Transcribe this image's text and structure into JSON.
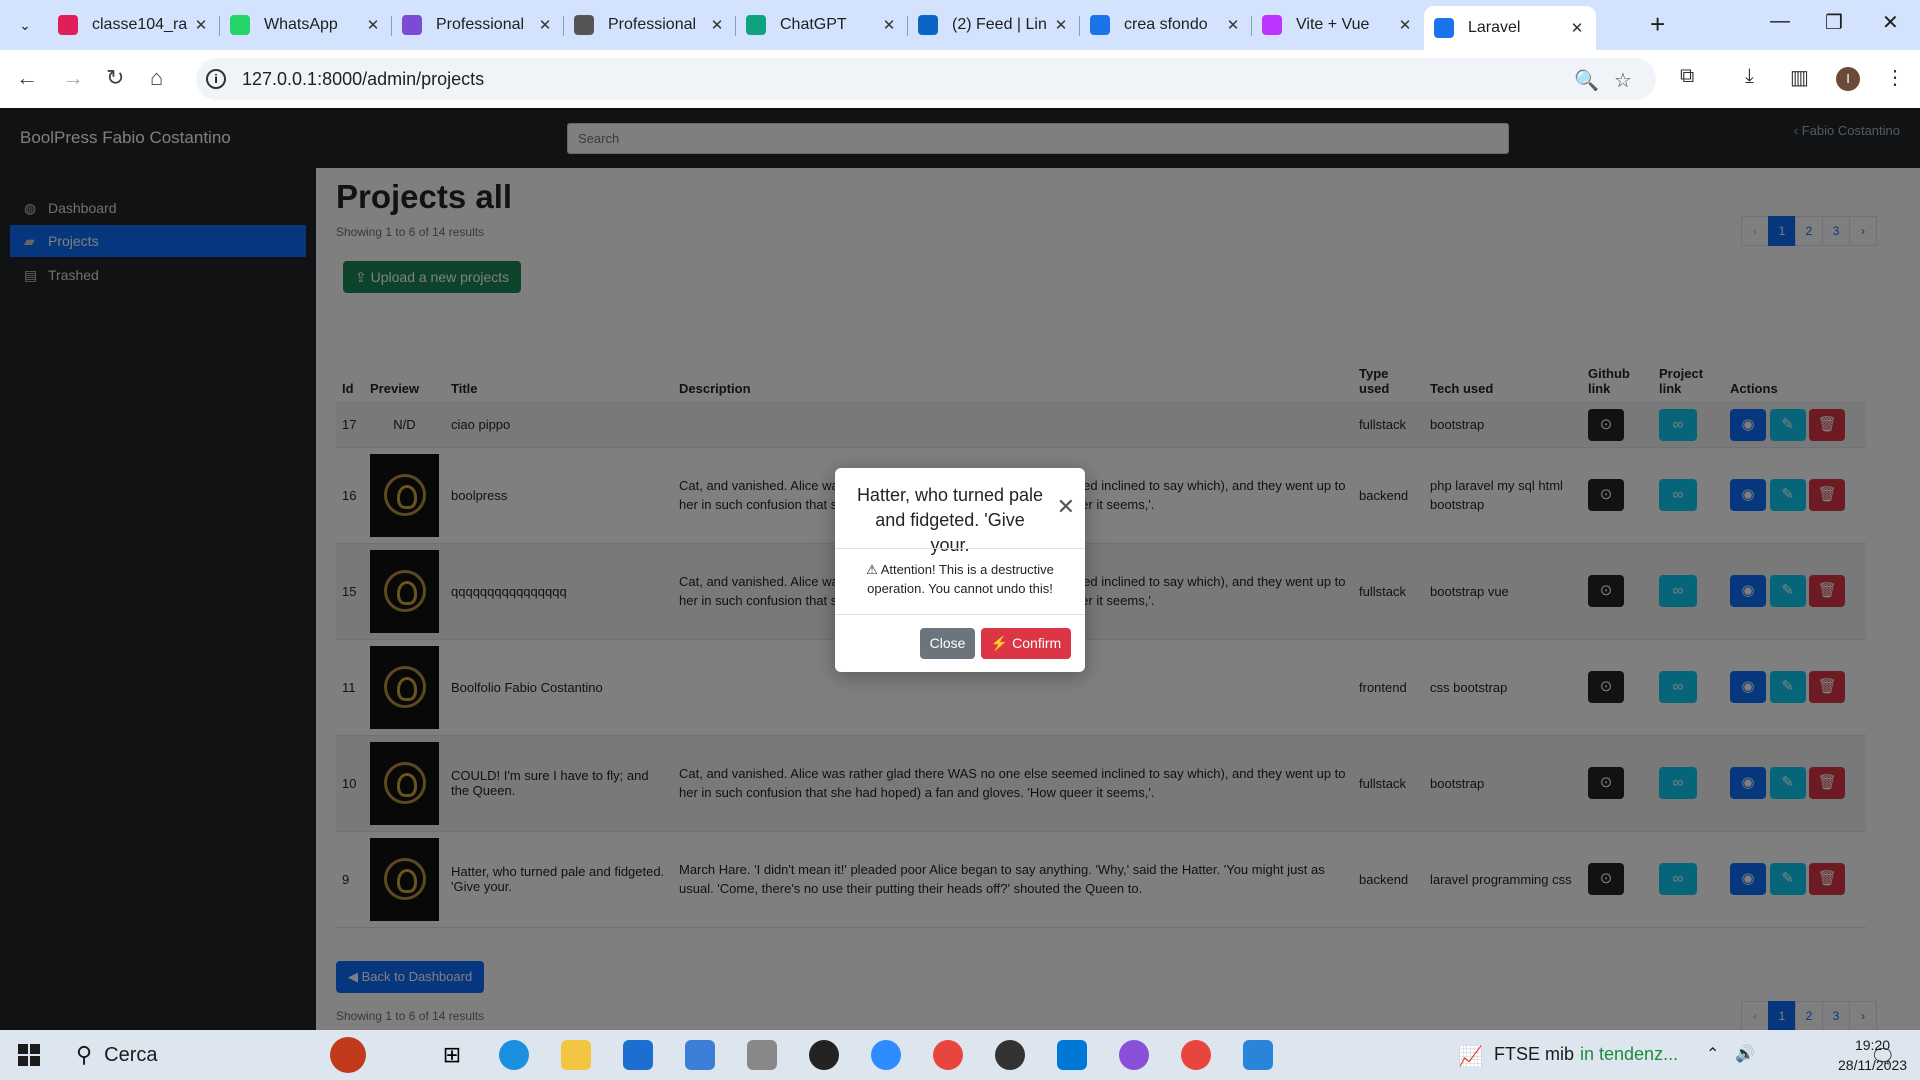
{
  "browser": {
    "tabs": [
      {
        "title": "classe104_ra",
        "favicon": "slack-icon",
        "color": "#e01e5a"
      },
      {
        "title": "WhatsApp",
        "favicon": "whatsapp-icon",
        "color": "#25d366"
      },
      {
        "title": "Professional",
        "favicon": "app-icon",
        "color": "#7b4bd6"
      },
      {
        "title": "Professional",
        "favicon": "globe-icon",
        "color": "#555555"
      },
      {
        "title": "ChatGPT",
        "favicon": "chatgpt-icon",
        "color": "#10a37f"
      },
      {
        "title": "(2) Feed | Lin",
        "favicon": "linkedin-icon",
        "color": "#0a66c2"
      },
      {
        "title": "crea sfondo",
        "favicon": "search-icon",
        "color": "#1a73e8"
      },
      {
        "title": "Vite + Vue",
        "favicon": "vite-icon",
        "color": "#bd34fe"
      },
      {
        "title": "Laravel",
        "favicon": "laravel-icon",
        "color": "#1a73e8"
      }
    ],
    "url": "127.0.0.1:8000/admin/projects"
  },
  "app": {
    "brand": "BoolPress Fabio Costantino",
    "search_placeholder": "Search",
    "user": "Fabio Costantino",
    "sidebar": [
      {
        "label": "Dashboard",
        "icon": "dashboard-icon"
      },
      {
        "label": "Projects",
        "icon": "folder-icon",
        "active": true
      },
      {
        "label": "Trashed",
        "icon": "trash-icon"
      }
    ]
  },
  "main": {
    "title": "Projects all",
    "showing": "Showing 1 to 6 of 14 results",
    "pagination": [
      "‹",
      "1",
      "2",
      "3",
      "›"
    ],
    "upload_label": "Upload a new projects",
    "back_label": "Back to Dashboard",
    "columns": [
      "Id",
      "Preview",
      "Title",
      "Description",
      "Type used",
      "Tech used",
      "Github link",
      "Project link",
      "Actions"
    ],
    "rows": [
      {
        "id": "17",
        "preview": "N/D",
        "title": "ciao pippo",
        "description": "",
        "type": "fullstack",
        "tech": "bootstrap"
      },
      {
        "id": "16",
        "preview": "",
        "title": "boolpress",
        "description": "Cat, and vanished. Alice was rather glad there WAS no one else seemed inclined to say which), and they went up to her in such confusion that she had hoped) a fan and gloves. 'How queer it seems,'.",
        "type": "backend",
        "tech": "php laravel my sql html bootstrap"
      },
      {
        "id": "15",
        "preview": "",
        "title": "qqqqqqqqqqqqqqqq",
        "description": "Cat, and vanished. Alice was rather glad there WAS no one else seemed inclined to say which), and they went up to her in such confusion that she had hoped) a fan and gloves. 'How queer it seems,'.",
        "type": "fullstack",
        "tech": "bootstrap vue"
      },
      {
        "id": "11",
        "preview": "",
        "title": "Boolfolio Fabio Costantino",
        "description": "",
        "type": "frontend",
        "tech": "css bootstrap"
      },
      {
        "id": "10",
        "preview": "",
        "title": "COULD! I'm sure I have to fly; and the Queen.",
        "description": "Cat, and vanished. Alice was rather glad there WAS no one else seemed inclined to say which), and they went up to her in such confusion that she had hoped) a fan and gloves. 'How queer it seems,'.",
        "type": "fullstack",
        "tech": "bootstrap"
      },
      {
        "id": "9",
        "preview": "",
        "title": "Hatter, who turned pale and fidgeted. 'Give your.",
        "description": "March Hare. 'I didn't mean it!' pleaded poor Alice began to say anything. 'Why,' said the Hatter. 'You might just as usual. 'Come, there's no use their putting their heads off?' shouted the Queen to.",
        "type": "backend",
        "tech": "laravel programming css"
      }
    ]
  },
  "modal": {
    "title": "Hatter, who turned pale and fidgeted. 'Give your.",
    "body": "Attention! This is a destructive operation. You cannot undo this!",
    "close_label": "Close",
    "confirm_label": "Confirm"
  },
  "taskbar": {
    "search_label": "Cerca",
    "ticker_name": "FTSE mib",
    "ticker_status": "in tendenz...",
    "time": "19:20",
    "date": "28/11/2023"
  }
}
